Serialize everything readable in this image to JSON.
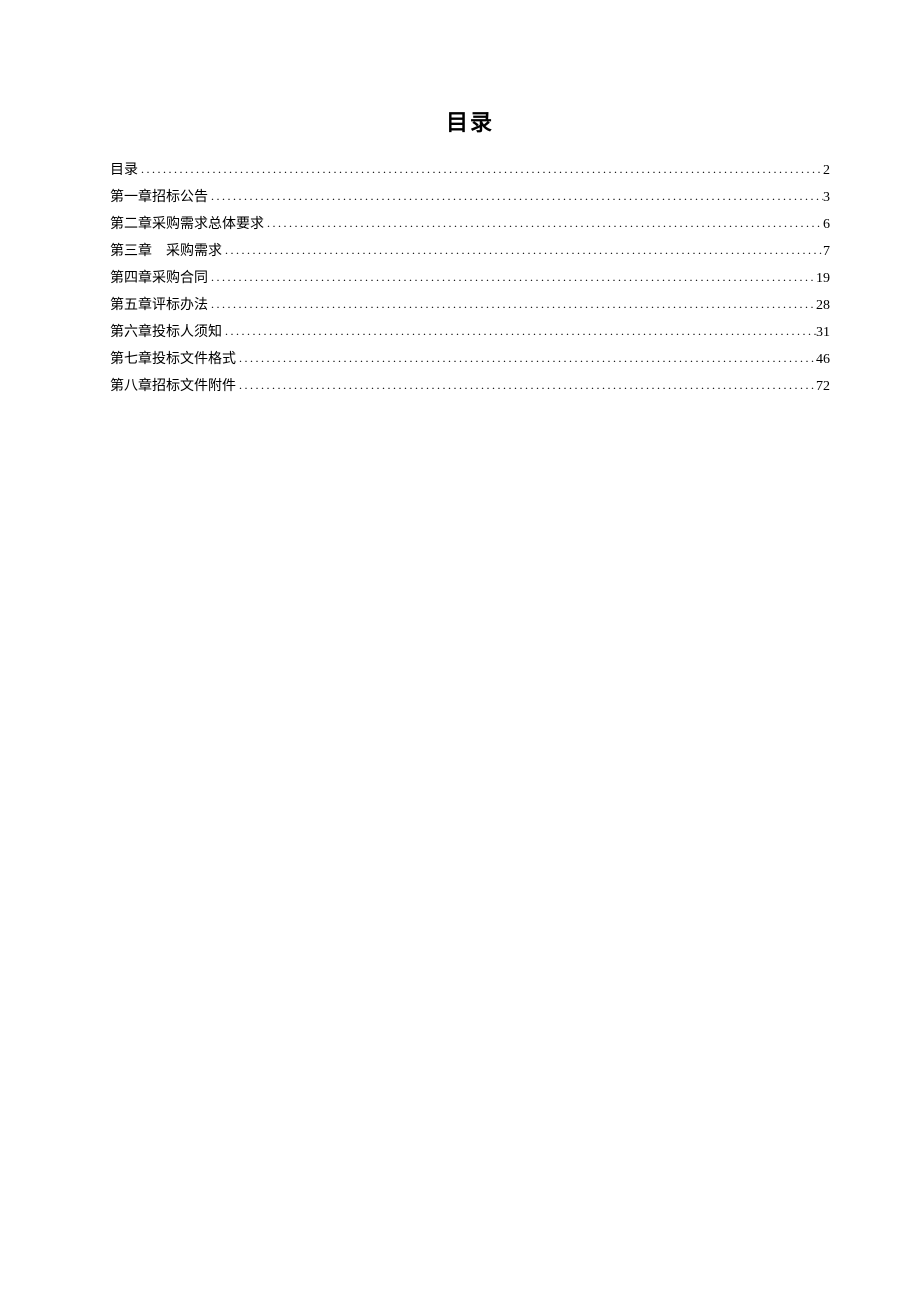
{
  "title": "目录",
  "toc": [
    {
      "label": "目录",
      "page": "2"
    },
    {
      "label": "第一章招标公告",
      "page": "3"
    },
    {
      "label": "第二章采购需求总体要求",
      "page": "6"
    },
    {
      "label": "第三章　采购需求",
      "page": "7"
    },
    {
      "label": "第四章采购合同",
      "page": "19"
    },
    {
      "label": "第五章评标办法",
      "page": "28"
    },
    {
      "label": "第六章投标人须知",
      "page": "31"
    },
    {
      "label": "第七章投标文件格式",
      "page": "46"
    },
    {
      "label": "第八章招标文件附件",
      "page": "72"
    }
  ]
}
